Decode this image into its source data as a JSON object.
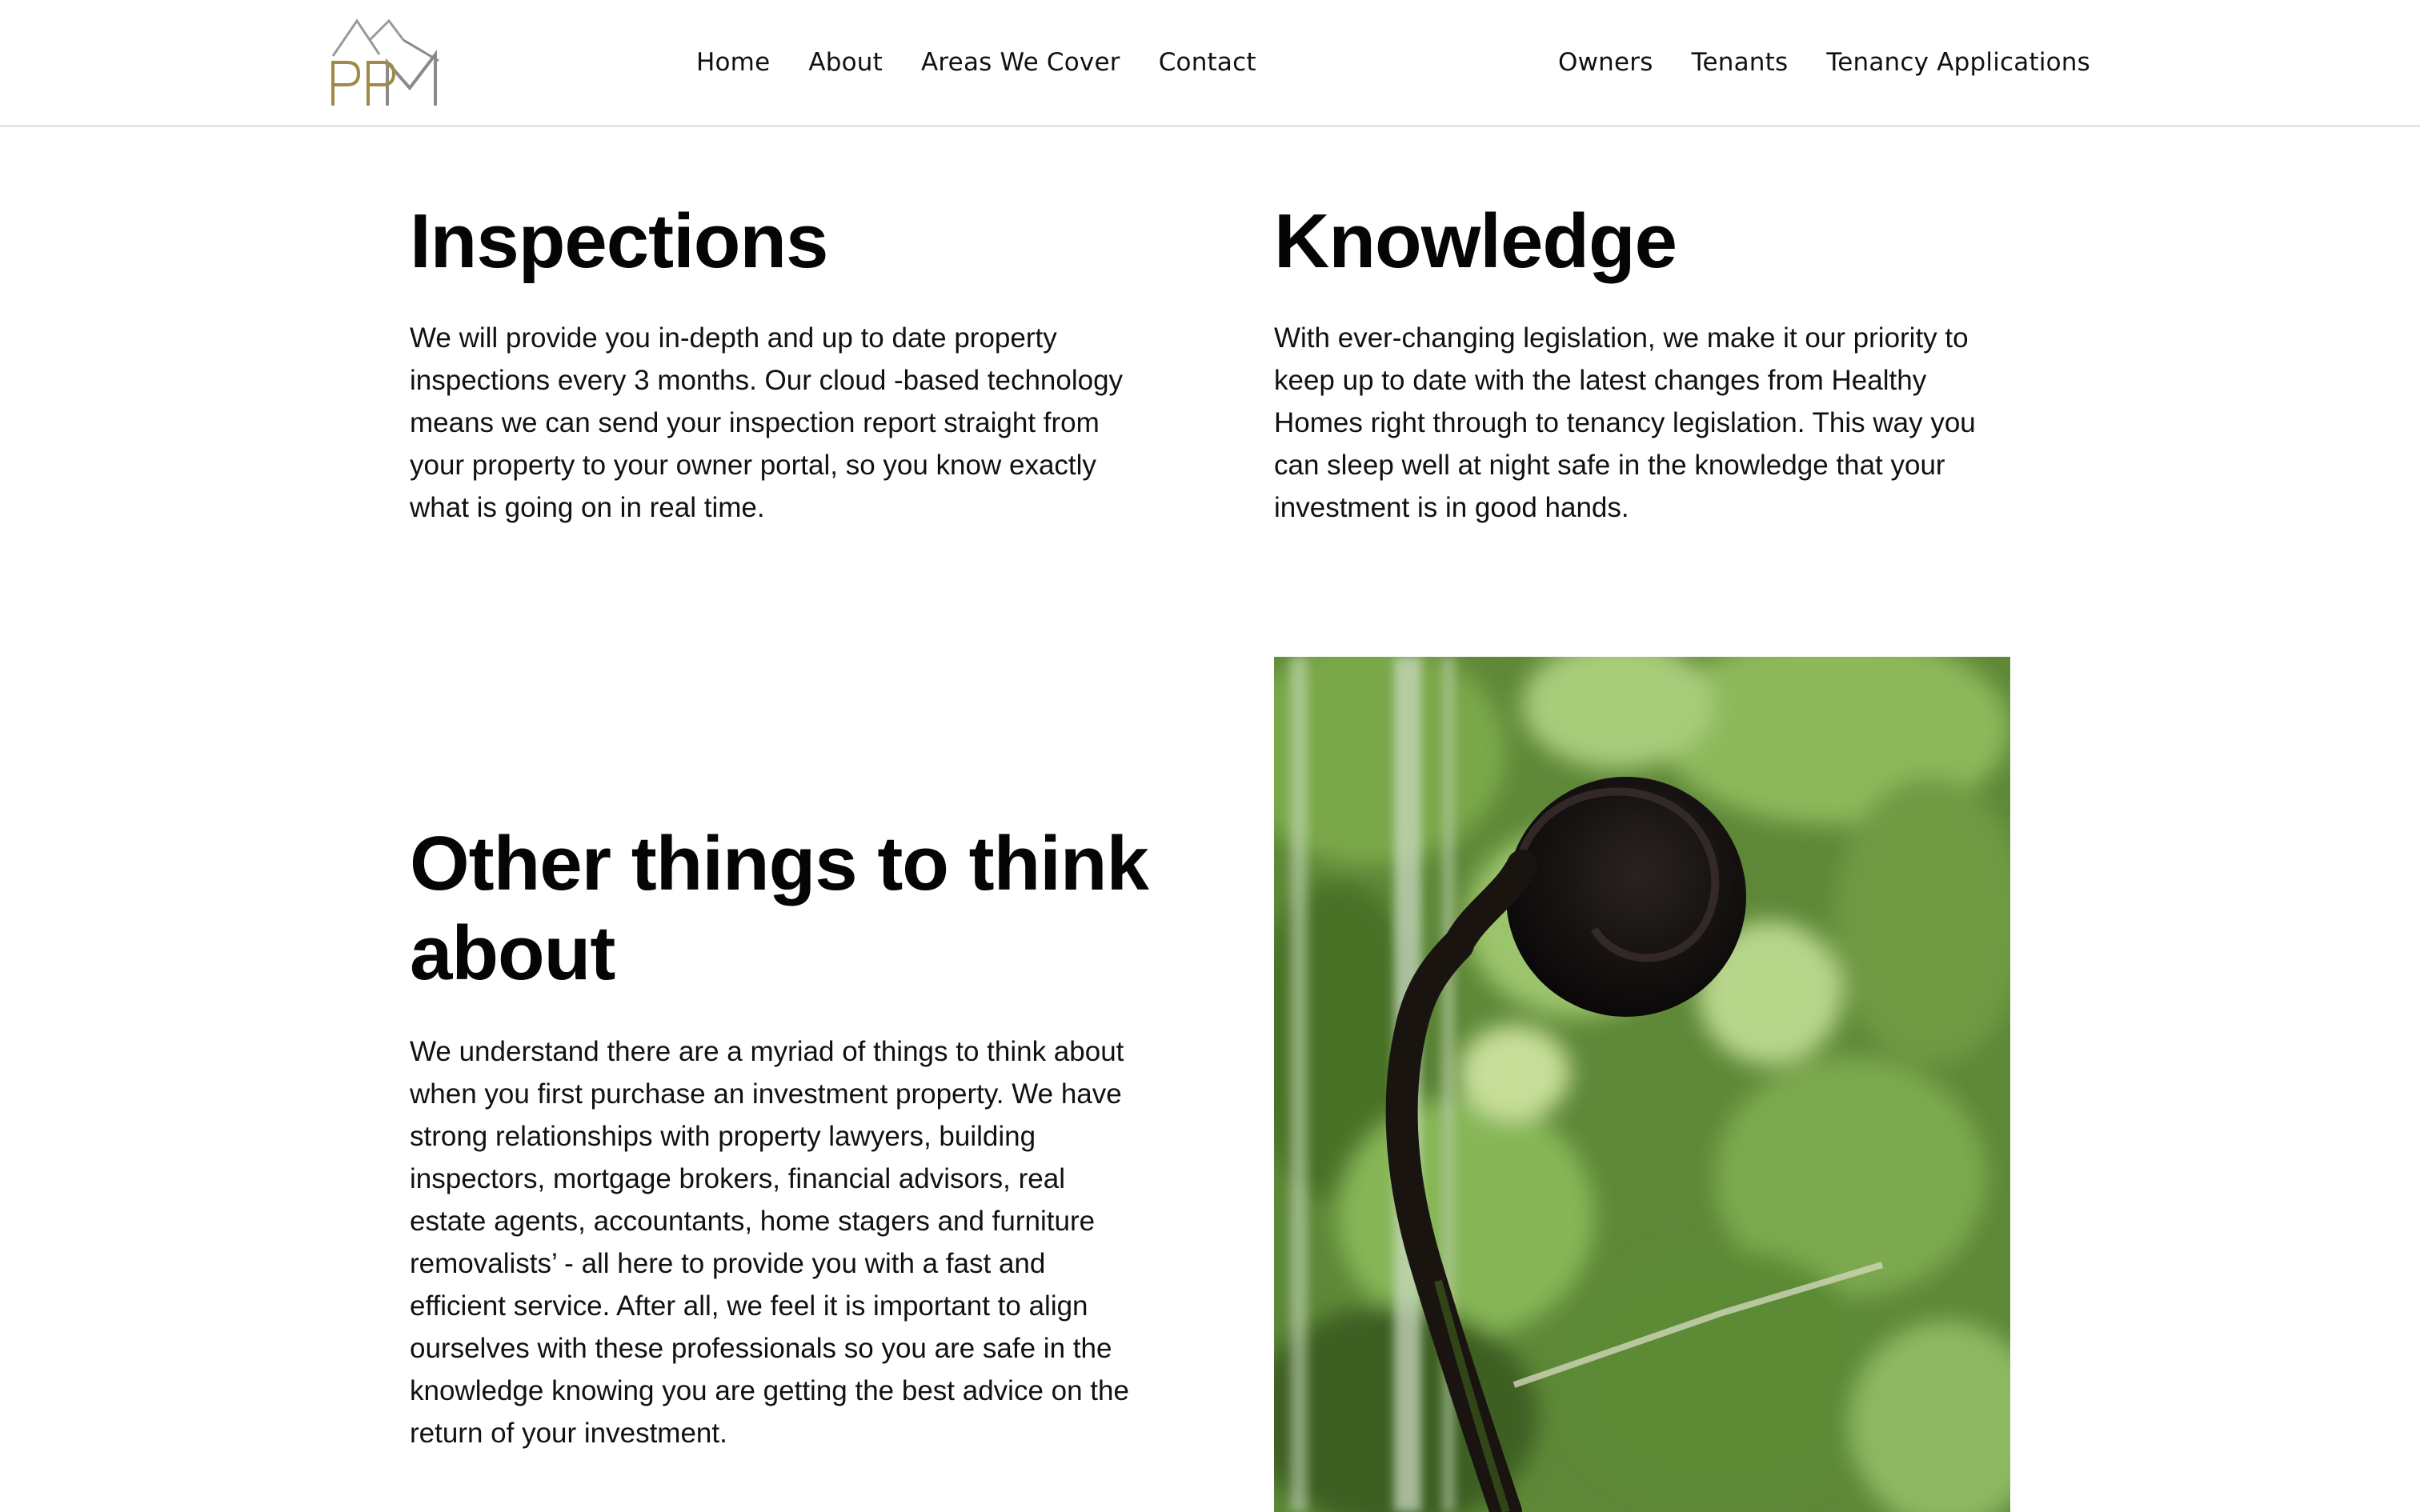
{
  "header": {
    "logo_alt": "PPM",
    "nav_left": [
      "Home",
      "About",
      "Areas We Cover",
      "Contact"
    ],
    "nav_right": [
      "Owners",
      "Tenants",
      "Tenancy Applications"
    ]
  },
  "sections": {
    "inspections": {
      "title": "Inspections",
      "text": "We will provide you in-depth and up to date property inspections every 3 months. Our cloud -based technology means we can send your inspection report straight from your property to your owner portal, so you know exactly what is going on in real time."
    },
    "knowledge": {
      "title": "Knowledge",
      "text": "With ever-changing legislation, we make it our priority to keep up to date with the latest changes from Healthy Homes right through to tenancy legislation. This way you can sleep well at night safe in the knowledge that your investment is in good hands."
    },
    "other": {
      "title": "Other things to think about",
      "text": "We understand there are a myriad of things to think about when you first purchase an investment property. We have strong relationships with property lawyers, building inspectors, mortgage brokers, financial advisors, real estate agents, accountants, home stagers and furniture removalists’ - all here to provide you with a fast and efficient service. After all, we feel it is important to align ourselves with these professionals so you are safe in the knowledge knowing you are getting the best advice on the return of your investment."
    }
  },
  "colors": {
    "logo_gold": "#a08a45",
    "logo_grey": "#8a8a8a",
    "text": "#111111",
    "foliage": "#5f8a3a"
  }
}
